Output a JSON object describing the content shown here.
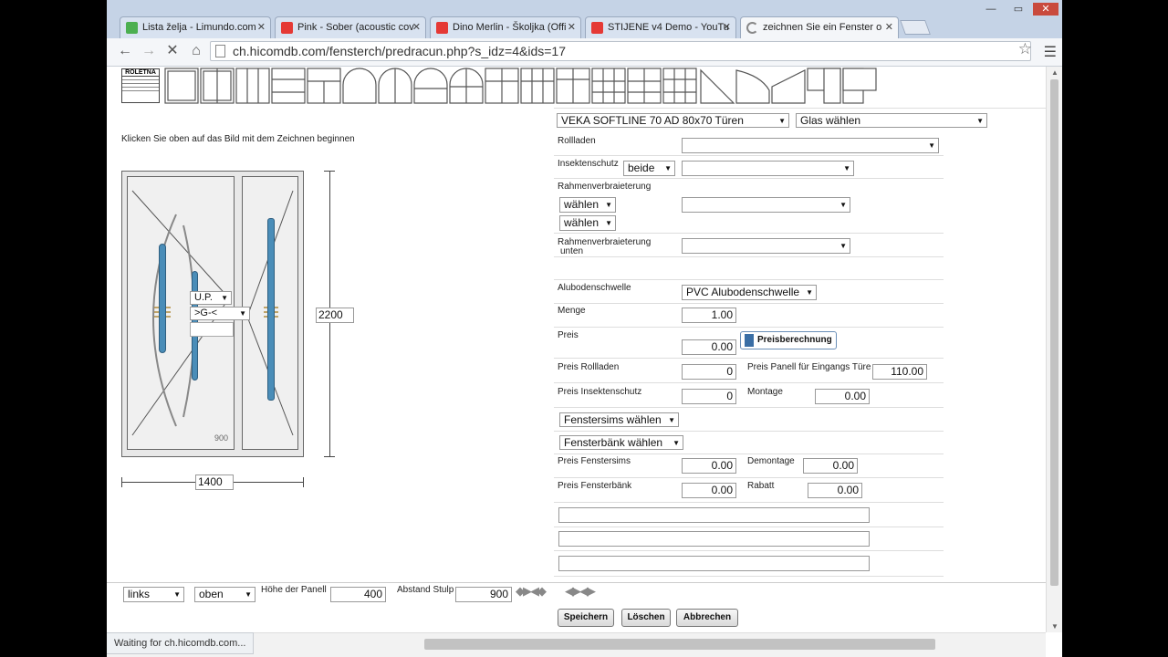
{
  "browser": {
    "tabs": [
      {
        "label": "Lista želja - Limundo.com",
        "color": "#4caf50"
      },
      {
        "label": "Pink - Sober (acoustic cov",
        "color": "#e53935"
      },
      {
        "label": "Dino Merlin - Školjka (Offi",
        "color": "#e53935"
      },
      {
        "label": "STIJENE v4 Demo - YouTu",
        "color": "#e53935"
      },
      {
        "label": "zeichnen Sie ein Fenster o",
        "color": "#888888"
      }
    ],
    "url": "ch.hicomdb.com/fensterch/predracun.php?s_idz=4&ids=17",
    "status": "Waiting for ch.hicomdb.com..."
  },
  "page": {
    "roletna_label": "ROLETNA",
    "instruction": "Klicken Sie oben auf das Bild mit dem Zeichnen beginnen",
    "profile_select": "VEKA SOFTLINE 70 AD 80x70 Türen",
    "glass_select": "Glas wählen",
    "door_label": "900",
    "door_up": "U.P.",
    "door_g": ">G-<",
    "height_value": "2200",
    "width_value": "1400",
    "labels": {
      "rollladen": "Rollladen",
      "insektenschutz": "Insektenschutz",
      "rahmen": "Rahmenverbraieterung",
      "rahmen_unten_1": "Rahmenverbraieterung",
      "rahmen_unten_2": "unten",
      "alubodenschwelle": "Alubodenschwelle",
      "menge": "Menge",
      "preis": "Preis",
      "preis_rollladen": "Preis Rollladen",
      "preis_panell": "Preis Panell für Eingangs Türe",
      "preis_insekten": "Preis Insektenschutz",
      "montage": "Montage",
      "preis_fenstersims": "Preis Fenstersims",
      "demontage": "Demontage",
      "preis_fensterbank": "Preis Fensterbänk",
      "rabatt": "Rabatt",
      "hoehe_panell": "Höhe der Panell",
      "abstand_stulp": "Abstand Stulp"
    },
    "selects": {
      "insekt_beide": "beide",
      "waehlen_1": "wählen",
      "waehlen_2": "wählen",
      "alubodenschwelle": "PVC Alubodenschwelle",
      "fenstersims": "Fenstersims wählen",
      "fensterbank": "Fensterbänk wählen",
      "links": "links",
      "oben": "oben"
    },
    "values": {
      "menge": "1.00",
      "preis": "0.00",
      "preis_rollladen": "0",
      "preis_panell": "110.00",
      "preis_insekten": "0",
      "montage": "0.00",
      "preis_fenstersims": "0.00",
      "demontage": "0.00",
      "preis_fensterbank": "0.00",
      "rabatt": "0.00",
      "hoehe_panell": "400",
      "abstand_stulp": "900"
    },
    "buttons": {
      "preisberechnung": "Preisberechnung",
      "speichern": "Speichern",
      "loeschen": "Löschen",
      "abbrechen": "Abbrechen"
    }
  }
}
